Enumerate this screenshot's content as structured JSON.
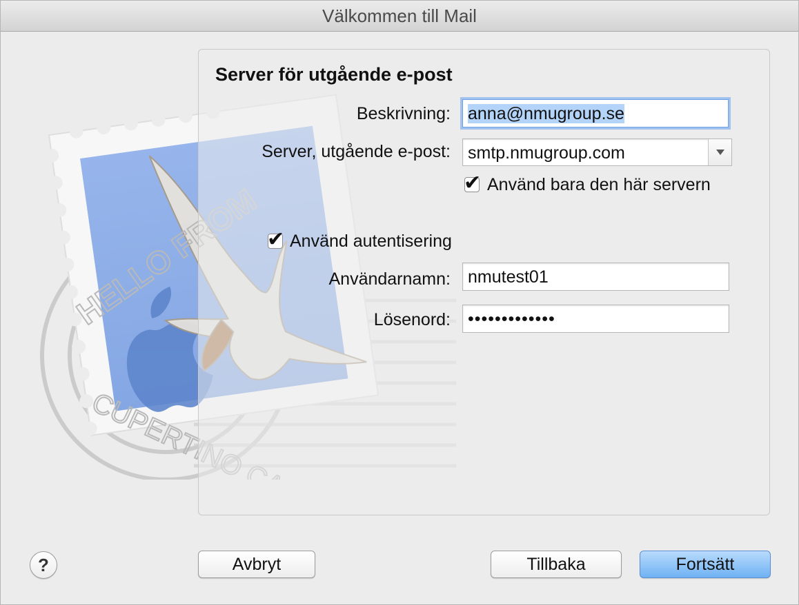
{
  "window": {
    "title": "Välkommen till Mail"
  },
  "illustration": {
    "postmark_top": "HELLO FROM",
    "postmark_bottom": "CUPERTINO CA"
  },
  "form": {
    "heading": "Server för utgående e-post",
    "description_label": "Beskrivning:",
    "description_value": "anna@nmugroup.se",
    "server_label": "Server, utgående e-post:",
    "server_value": "smtp.nmugroup.com",
    "only_this_server_label": "Använd bara den här servern",
    "only_this_server_checked": true,
    "use_auth_label": "Använd autentisering",
    "use_auth_checked": true,
    "username_label": "Användarnamn:",
    "username_value": "nmutest01",
    "password_label": "Lösenord:",
    "password_value": "•••••••••••••"
  },
  "buttons": {
    "help": "?",
    "cancel": "Avbryt",
    "back": "Tillbaka",
    "continue": "Fortsätt"
  },
  "colors": {
    "primary_button": "#6fb2f4",
    "focus_ring": "#64a0f0",
    "selection": "#b3d3f8"
  }
}
